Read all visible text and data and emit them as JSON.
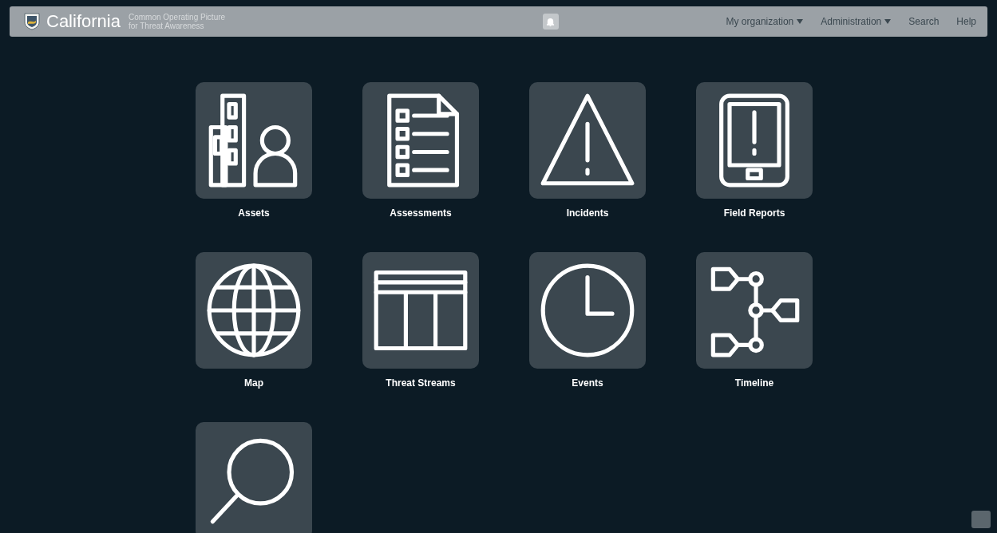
{
  "header": {
    "title": "California",
    "subtitle_line_1": "Common Operating Picture",
    "subtitle_line_2": "for Threat Awareness",
    "nav": [
      {
        "label": "My organization",
        "dropdown": true
      },
      {
        "label": "Administration",
        "dropdown": true
      },
      {
        "label": "Search",
        "dropdown": false
      },
      {
        "label": "Help",
        "dropdown": false
      }
    ]
  },
  "tiles": [
    {
      "kind": "assets",
      "label": "Assets"
    },
    {
      "kind": "assessments",
      "label": "Assessments"
    },
    {
      "kind": "incidents",
      "label": "Incidents"
    },
    {
      "kind": "field_reports",
      "label": "Field Reports"
    },
    {
      "kind": "map",
      "label": "Map"
    },
    {
      "kind": "threat_streams",
      "label": "Threat Streams"
    },
    {
      "kind": "events",
      "label": "Events"
    },
    {
      "kind": "timeline",
      "label": "Timeline"
    },
    {
      "kind": "search"
    }
  ]
}
